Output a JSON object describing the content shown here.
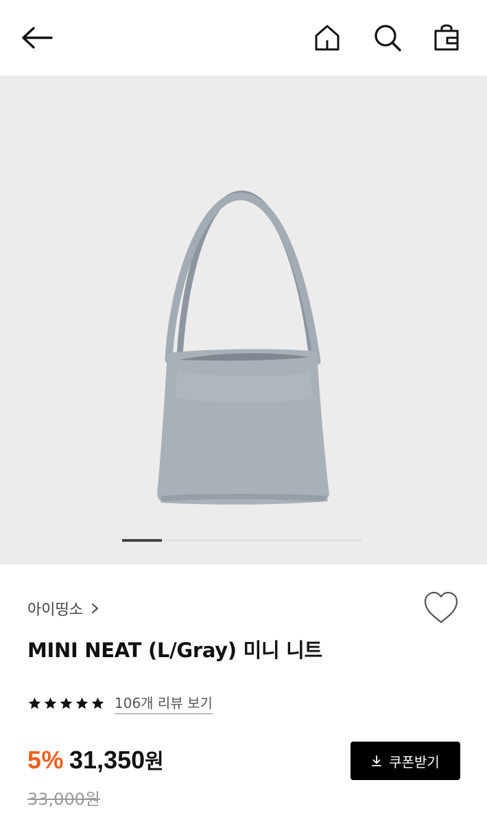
{
  "header": {
    "icons": [
      "back-arrow-icon",
      "home-icon",
      "search-icon",
      "shopping-bag-icon"
    ]
  },
  "gallery": {
    "current_index": 1,
    "colors": {
      "background": "#ececec",
      "bag": "#a9b1b8",
      "indicator_active": "#444444"
    }
  },
  "product": {
    "brand": "아이띵소",
    "title": "MINI NEAT (L/Gray) 미니 니트",
    "rating_stars": 5,
    "review_link": "106개 리뷰 보기",
    "discount": "5%",
    "price": "31,350",
    "price_unit": "원",
    "original_price": "33,000원",
    "coupon_button": "쿠폰받기"
  },
  "colors": {
    "discount": "#f0601c",
    "coupon_button_bg": "#000000"
  }
}
